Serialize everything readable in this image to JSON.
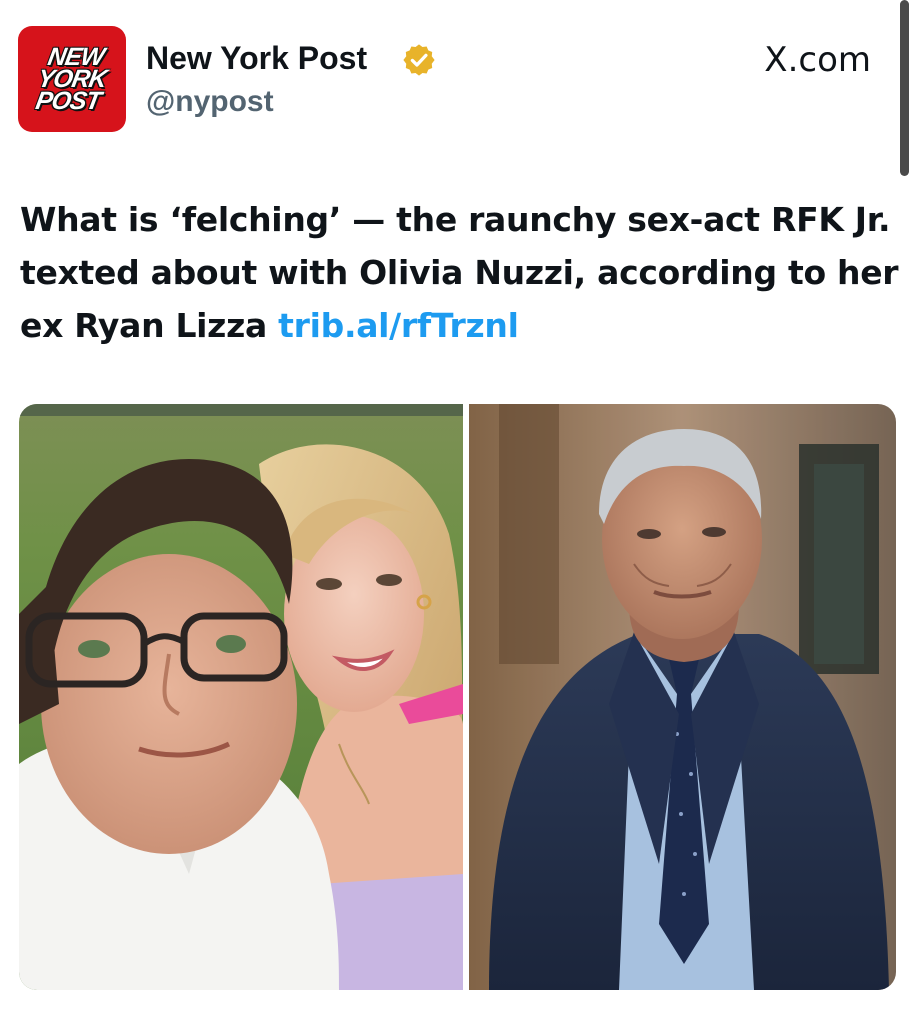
{
  "post": {
    "logo_lines": [
      "NEW",
      "YORK",
      "POST"
    ],
    "account_name": "New York Post",
    "handle": "@nypost",
    "source": "X.com",
    "headline_text": "What is ‘felching’ — the raunchy sex-act RFK Jr. texted about with Olivia Nuzzi, according to her ex Ryan Lizza ",
    "headline_link": "trib.al/rfTrznl"
  },
  "icons": {
    "verified": "verified-badge-icon",
    "logo": "new-york-post-logo"
  },
  "colors": {
    "brand_red": "#d6131b",
    "verified_gold": "#e8b32a",
    "link_blue": "#1d9bf0",
    "handle_gray": "#536471",
    "text": "#0f1419"
  }
}
